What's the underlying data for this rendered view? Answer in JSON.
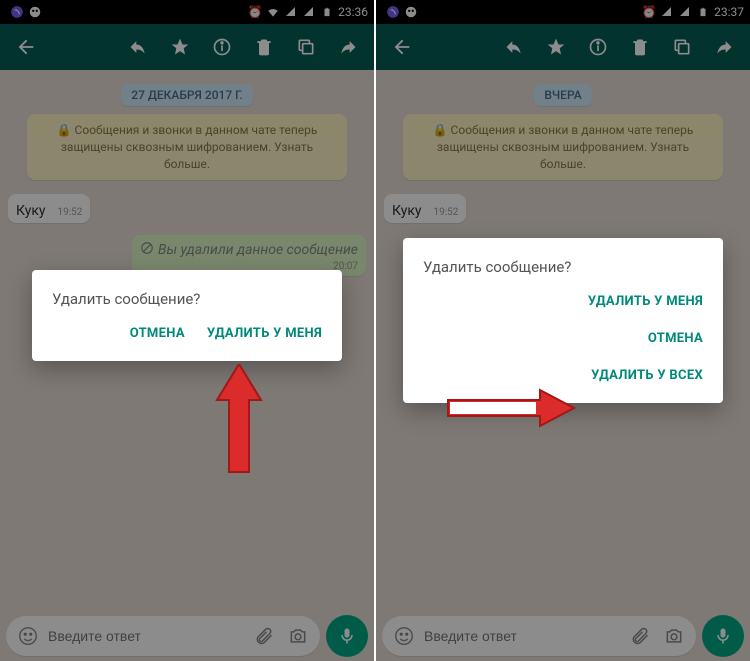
{
  "colors": {
    "primary": "#075e54",
    "accent": "#00a884",
    "dialog_btn": "#00897b",
    "arrow": "#db2b2b"
  },
  "left": {
    "status": {
      "time": "23:36"
    },
    "chat": {
      "date_badge": "27 ДЕКАБРЯ 2017 Г.",
      "encryption": "🔒 Сообщения и звонки в данном чате теперь защищены сквозным шифрованием. Узнать больше.",
      "msg1": {
        "text": "Куку",
        "time": "19:52"
      },
      "deleted": {
        "text": "Вы удалили данное сообщение",
        "time": "20:07"
      }
    },
    "input": {
      "placeholder": "Введите ответ"
    },
    "dialog": {
      "title": "Удалить сообщение?",
      "cancel": "ОТМЕНА",
      "delete_me": "УДАЛИТЬ У МЕНЯ"
    }
  },
  "right": {
    "status": {
      "time": "23:37"
    },
    "chat": {
      "date_badge": "ВЧЕРА",
      "encryption": "🔒 Сообщения и звонки в данном чате теперь защищены сквозным шифрованием. Узнать больше.",
      "msg1": {
        "text": "Куку",
        "time": "19:52"
      }
    },
    "input": {
      "placeholder": "Введите ответ"
    },
    "dialog": {
      "title": "Удалить сообщение?",
      "delete_me": "УДАЛИТЬ У МЕНЯ",
      "cancel": "ОТМЕНА",
      "delete_all": "УДАЛИТЬ У ВСЕХ"
    }
  }
}
